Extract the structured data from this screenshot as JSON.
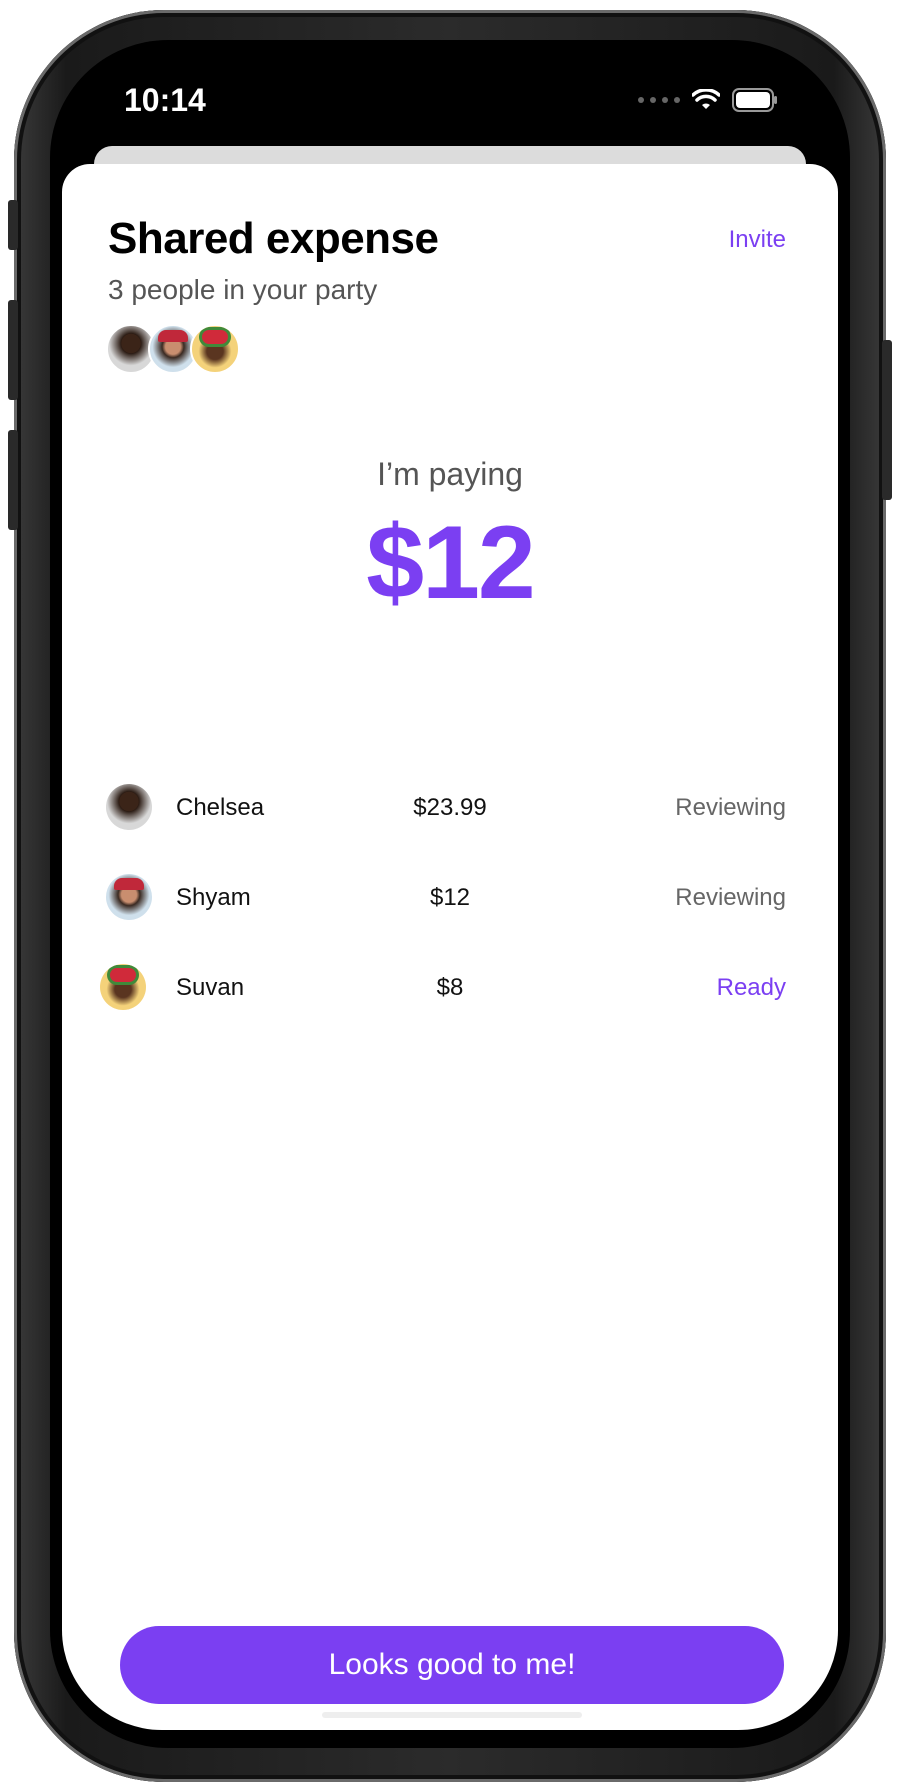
{
  "status_bar": {
    "time": "10:14"
  },
  "header": {
    "title": "Shared expense",
    "invite_label": "Invite",
    "subtitle": "3 people in your party"
  },
  "paying": {
    "label": "I’m paying",
    "amount": "$12"
  },
  "members": [
    {
      "name": "Chelsea",
      "amount": "$23.99",
      "status": "Reviewing"
    },
    {
      "name": "Shyam",
      "amount": "$12",
      "status": "Reviewing"
    },
    {
      "name": "Suvan",
      "amount": "$8",
      "status": "Ready"
    }
  ],
  "cta_label": "Looks good to me!",
  "colors": {
    "accent": "#7b3ff2",
    "muted": "#666666"
  }
}
